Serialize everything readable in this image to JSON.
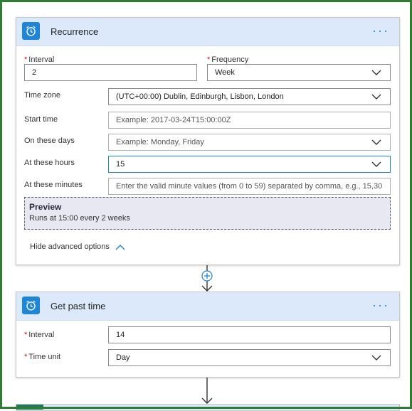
{
  "recurrence": {
    "title": "Recurrence",
    "more_label": "···",
    "interval": {
      "label": "Interval",
      "value": "2"
    },
    "frequency": {
      "label": "Frequency",
      "value": "Week"
    },
    "time_zone": {
      "label": "Time zone",
      "value": "(UTC+00:00) Dublin, Edinburgh, Lisbon, London"
    },
    "start_time": {
      "label": "Start time",
      "placeholder": "Example: 2017-03-24T15:00:00Z"
    },
    "on_these_days": {
      "label": "On these days",
      "placeholder": "Example: Monday, Friday"
    },
    "at_these_hours": {
      "label": "At these hours",
      "value": "15"
    },
    "at_these_minutes": {
      "label": "At these minutes",
      "placeholder": "Enter the valid minute values (from 0 to 59) separated by comma, e.g., 15,30"
    },
    "preview": {
      "title": "Preview",
      "text": "Runs at 15:00 every 2 weeks"
    },
    "advanced_toggle": "Hide advanced options"
  },
  "get_past_time": {
    "title": "Get past time",
    "more_label": "···",
    "interval": {
      "label": "Interval",
      "value": "14"
    },
    "time_unit": {
      "label": "Time unit",
      "value": "Day"
    }
  },
  "required_marker": "*",
  "colors": {
    "accent": "#1f85d6",
    "header_bg": "#dbe9fb",
    "frame": "#2f7d32",
    "preview_bg": "#e8e8f3",
    "required": "#c50f1f"
  },
  "icons": {
    "card_icon": "alarm-clock-icon",
    "dropdown": "chevron-down-icon",
    "collapse": "chevron-up-icon",
    "add_step": "plus-circle-icon",
    "flow_arrow": "arrow-down-icon"
  }
}
